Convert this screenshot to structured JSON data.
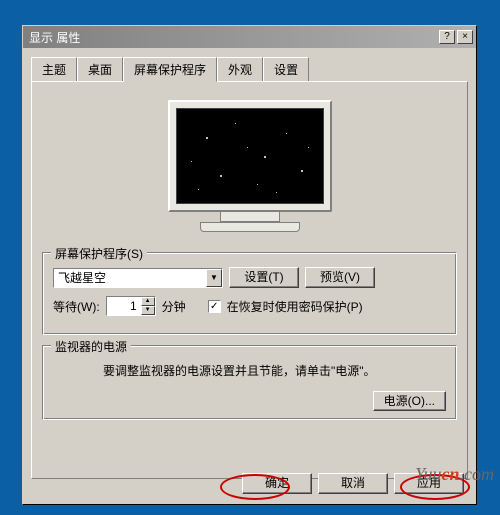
{
  "window": {
    "title": "显示 属性",
    "help": "?",
    "close": "×"
  },
  "tabs": [
    "主题",
    "桌面",
    "屏幕保护程序",
    "外观",
    "设置"
  ],
  "active_tab_index": 2,
  "screensaver": {
    "group_label": "屏幕保护程序(S)",
    "selected": "飞越星空",
    "dropdown_glyph": "▼",
    "settings_btn": "设置(T)",
    "preview_btn": "预览(V)",
    "wait_label": "等待(W):",
    "wait_value": "1",
    "wait_unit": "分钟",
    "spin_up": "▲",
    "spin_down": "▼",
    "resume_check": "✓",
    "resume_label": "在恢复时使用密码保护(P)"
  },
  "power": {
    "group_label": "监视器的电源",
    "desc": "要调整监视器的电源设置并且节能，请单击\"电源\"。",
    "power_btn": "电源(O)..."
  },
  "buttons": {
    "ok": "确定",
    "cancel": "取消",
    "apply": "应用"
  },
  "watermark": {
    "pre": "Yuu",
    "hi": "cn",
    "post": ".com"
  }
}
